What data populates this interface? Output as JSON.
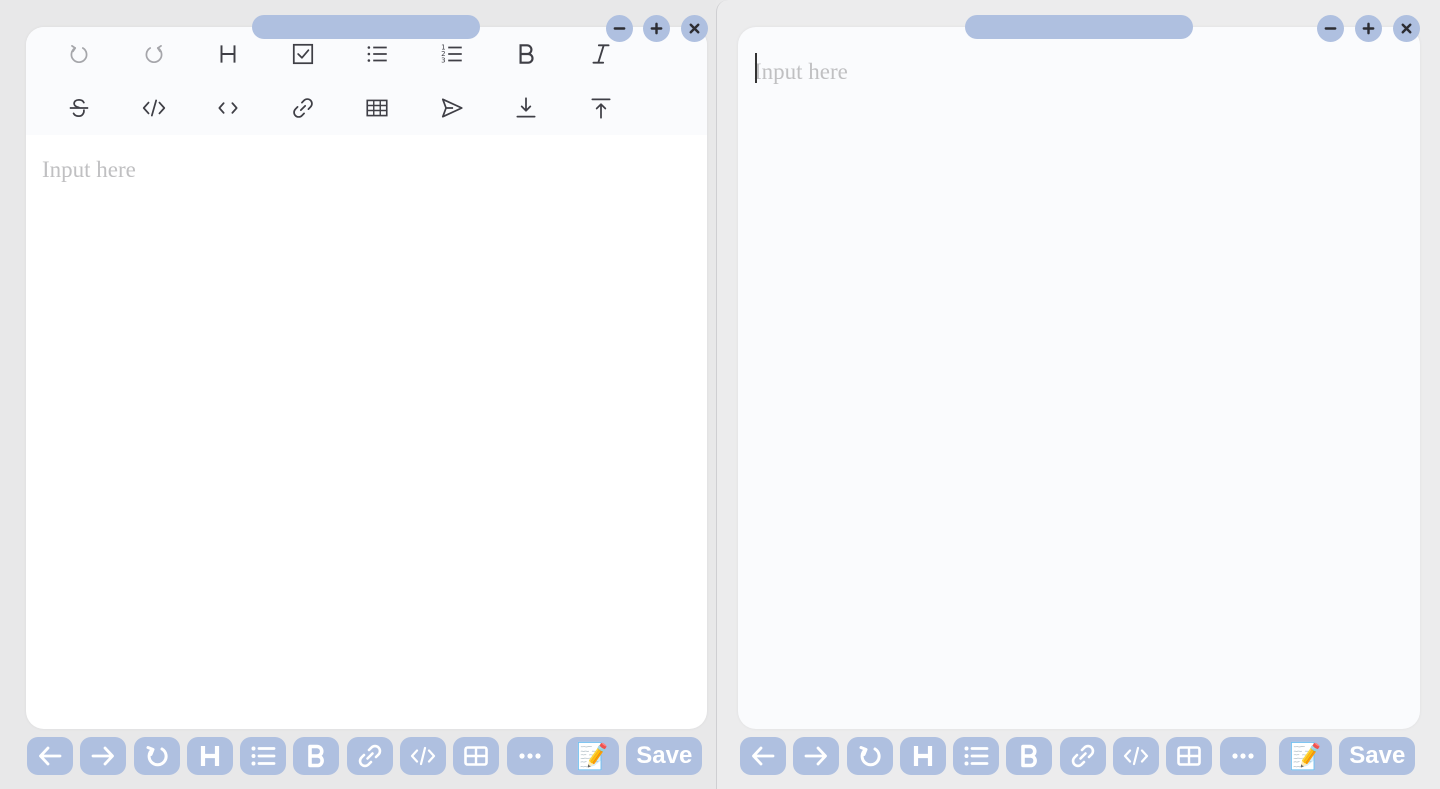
{
  "colors": {
    "accent": "#afc0e0",
    "icon_dark": "#3f3f46",
    "placeholder": "#c0c0c2",
    "card_bg": "#ffffff",
    "toolbar_bg": "#fafbfd"
  },
  "window_controls": {
    "minimize_icon": "minus-icon",
    "maximize_icon": "plus-icon",
    "close_icon": "close-icon"
  },
  "left_editor": {
    "toolbar": [
      {
        "name": "undo",
        "icon": "undo-icon",
        "disabled": true
      },
      {
        "name": "redo",
        "icon": "redo-icon",
        "disabled": true
      },
      {
        "name": "heading",
        "icon": "heading-icon"
      },
      {
        "name": "task-list",
        "icon": "checkbox-icon"
      },
      {
        "name": "bullet-list",
        "icon": "bullet-list-icon"
      },
      {
        "name": "ordered-list",
        "icon": "ordered-list-icon"
      },
      {
        "name": "bold",
        "icon": "bold-icon"
      },
      {
        "name": "italic",
        "icon": "italic-icon"
      },
      {
        "name": "strikethrough",
        "icon": "strikethrough-icon"
      },
      {
        "name": "code-block",
        "icon": "code-block-icon"
      },
      {
        "name": "inline-code",
        "icon": "inline-code-icon"
      },
      {
        "name": "link",
        "icon": "link-icon"
      },
      {
        "name": "table",
        "icon": "table-icon"
      },
      {
        "name": "send",
        "icon": "send-icon"
      },
      {
        "name": "download",
        "icon": "download-icon"
      },
      {
        "name": "upload",
        "icon": "upload-icon"
      }
    ],
    "placeholder": "Input here"
  },
  "right_editor": {
    "placeholder": "Input here",
    "focused": true
  },
  "bottom_bar": {
    "buttons": [
      {
        "name": "back",
        "icon": "arrow-left-icon"
      },
      {
        "name": "forward",
        "icon": "arrow-right-icon"
      },
      {
        "name": "refresh",
        "icon": "refresh-icon"
      },
      {
        "name": "heading",
        "icon": "heading-icon"
      },
      {
        "name": "list",
        "icon": "list-icon"
      },
      {
        "name": "bold",
        "icon": "bold-icon"
      },
      {
        "name": "link",
        "icon": "link-icon"
      },
      {
        "name": "code",
        "icon": "code-icon"
      },
      {
        "name": "table",
        "icon": "table-icon"
      },
      {
        "name": "more",
        "icon": "more-icon"
      },
      {
        "name": "note",
        "icon": "memo-icon",
        "glyph": "📝"
      }
    ],
    "save_label": "Save"
  }
}
